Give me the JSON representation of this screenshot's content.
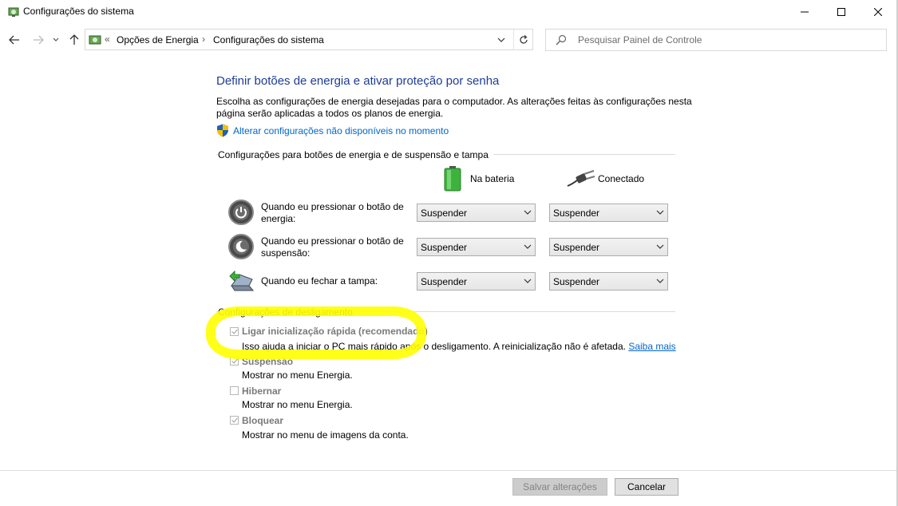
{
  "window": {
    "title": "Configurações do sistema",
    "controls": {
      "minimize": "minimize-icon",
      "maximize": "maximize-icon",
      "close": "close-icon"
    }
  },
  "address": {
    "overflow": "«",
    "crumbs": [
      "Opções de Energia",
      "Configurações do sistema"
    ],
    "separator": "›"
  },
  "search": {
    "placeholder": "Pesquisar Painel de Controle"
  },
  "content": {
    "title": "Definir botões de energia e ativar proteção por senha",
    "description": "Escolha as configurações de energia desejadas para o computador. As alterações feitas às configurações nesta página serão aplicadas a todos os planos de energia.",
    "change_link": "Alterar configurações não disponíveis no momento"
  },
  "power_section": {
    "title": "Configurações para botões de energia e de suspensão e tampa",
    "battery_label": "Na bateria",
    "plugged_label": "Conectado",
    "rows": [
      {
        "label": "Quando eu pressionar o botão de energia:",
        "battery": "Suspender",
        "plugged": "Suspender",
        "icon": "power-button-icon"
      },
      {
        "label": "Quando eu pressionar o botão de suspensão:",
        "battery": "Suspender",
        "plugged": "Suspender",
        "icon": "sleep-button-icon"
      },
      {
        "label": "Quando eu fechar a tampa:",
        "battery": "Suspender",
        "plugged": "Suspender",
        "icon": "laptop-lid-icon"
      }
    ]
  },
  "shutdown_section": {
    "title": "Configurações de desligamento",
    "options": [
      {
        "label": "Ligar inicialização rápida (recomendado)",
        "desc": "Isso ajuda a iniciar o PC mais rápido após o desligamento. A reinicialização não é afetada.",
        "link": "Saiba mais",
        "checked": true
      },
      {
        "label": "Suspensão",
        "desc": "Mostrar no menu Energia.",
        "checked": true
      },
      {
        "label": "Hibernar",
        "desc": "Mostrar no menu Energia.",
        "checked": false
      },
      {
        "label": "Bloquear",
        "desc": "Mostrar no menu de imagens da conta.",
        "checked": true
      }
    ]
  },
  "footer": {
    "save": "Salvar alterações",
    "cancel": "Cancelar"
  },
  "colors": {
    "title_blue": "#1e3c96",
    "link_blue": "#0066cc",
    "highlight": "#ffff00"
  }
}
